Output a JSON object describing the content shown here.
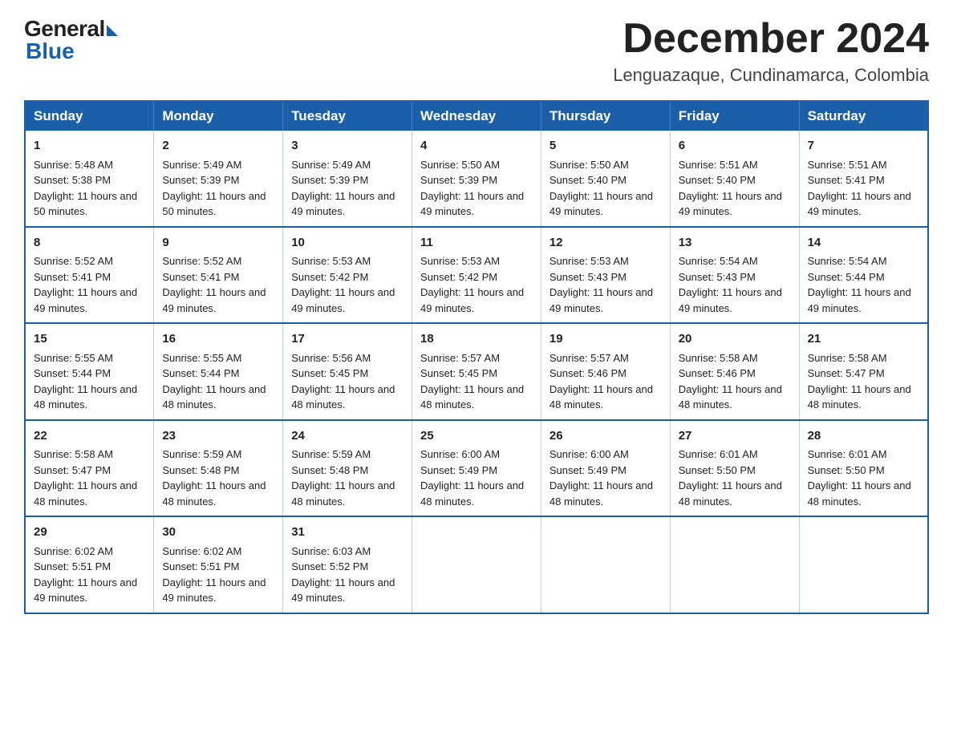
{
  "logo": {
    "general": "General",
    "blue": "Blue"
  },
  "header": {
    "title": "December 2024",
    "subtitle": "Lenguazaque, Cundinamarca, Colombia"
  },
  "weekdays": [
    "Sunday",
    "Monday",
    "Tuesday",
    "Wednesday",
    "Thursday",
    "Friday",
    "Saturday"
  ],
  "weeks": [
    [
      {
        "day": 1,
        "sunrise": "5:48 AM",
        "sunset": "5:38 PM",
        "daylight": "11 hours and 50 minutes."
      },
      {
        "day": 2,
        "sunrise": "5:49 AM",
        "sunset": "5:39 PM",
        "daylight": "11 hours and 50 minutes."
      },
      {
        "day": 3,
        "sunrise": "5:49 AM",
        "sunset": "5:39 PM",
        "daylight": "11 hours and 49 minutes."
      },
      {
        "day": 4,
        "sunrise": "5:50 AM",
        "sunset": "5:39 PM",
        "daylight": "11 hours and 49 minutes."
      },
      {
        "day": 5,
        "sunrise": "5:50 AM",
        "sunset": "5:40 PM",
        "daylight": "11 hours and 49 minutes."
      },
      {
        "day": 6,
        "sunrise": "5:51 AM",
        "sunset": "5:40 PM",
        "daylight": "11 hours and 49 minutes."
      },
      {
        "day": 7,
        "sunrise": "5:51 AM",
        "sunset": "5:41 PM",
        "daylight": "11 hours and 49 minutes."
      }
    ],
    [
      {
        "day": 8,
        "sunrise": "5:52 AM",
        "sunset": "5:41 PM",
        "daylight": "11 hours and 49 minutes."
      },
      {
        "day": 9,
        "sunrise": "5:52 AM",
        "sunset": "5:41 PM",
        "daylight": "11 hours and 49 minutes."
      },
      {
        "day": 10,
        "sunrise": "5:53 AM",
        "sunset": "5:42 PM",
        "daylight": "11 hours and 49 minutes."
      },
      {
        "day": 11,
        "sunrise": "5:53 AM",
        "sunset": "5:42 PM",
        "daylight": "11 hours and 49 minutes."
      },
      {
        "day": 12,
        "sunrise": "5:53 AM",
        "sunset": "5:43 PM",
        "daylight": "11 hours and 49 minutes."
      },
      {
        "day": 13,
        "sunrise": "5:54 AM",
        "sunset": "5:43 PM",
        "daylight": "11 hours and 49 minutes."
      },
      {
        "day": 14,
        "sunrise": "5:54 AM",
        "sunset": "5:44 PM",
        "daylight": "11 hours and 49 minutes."
      }
    ],
    [
      {
        "day": 15,
        "sunrise": "5:55 AM",
        "sunset": "5:44 PM",
        "daylight": "11 hours and 48 minutes."
      },
      {
        "day": 16,
        "sunrise": "5:55 AM",
        "sunset": "5:44 PM",
        "daylight": "11 hours and 48 minutes."
      },
      {
        "day": 17,
        "sunrise": "5:56 AM",
        "sunset": "5:45 PM",
        "daylight": "11 hours and 48 minutes."
      },
      {
        "day": 18,
        "sunrise": "5:57 AM",
        "sunset": "5:45 PM",
        "daylight": "11 hours and 48 minutes."
      },
      {
        "day": 19,
        "sunrise": "5:57 AM",
        "sunset": "5:46 PM",
        "daylight": "11 hours and 48 minutes."
      },
      {
        "day": 20,
        "sunrise": "5:58 AM",
        "sunset": "5:46 PM",
        "daylight": "11 hours and 48 minutes."
      },
      {
        "day": 21,
        "sunrise": "5:58 AM",
        "sunset": "5:47 PM",
        "daylight": "11 hours and 48 minutes."
      }
    ],
    [
      {
        "day": 22,
        "sunrise": "5:58 AM",
        "sunset": "5:47 PM",
        "daylight": "11 hours and 48 minutes."
      },
      {
        "day": 23,
        "sunrise": "5:59 AM",
        "sunset": "5:48 PM",
        "daylight": "11 hours and 48 minutes."
      },
      {
        "day": 24,
        "sunrise": "5:59 AM",
        "sunset": "5:48 PM",
        "daylight": "11 hours and 48 minutes."
      },
      {
        "day": 25,
        "sunrise": "6:00 AM",
        "sunset": "5:49 PM",
        "daylight": "11 hours and 48 minutes."
      },
      {
        "day": 26,
        "sunrise": "6:00 AM",
        "sunset": "5:49 PM",
        "daylight": "11 hours and 48 minutes."
      },
      {
        "day": 27,
        "sunrise": "6:01 AM",
        "sunset": "5:50 PM",
        "daylight": "11 hours and 48 minutes."
      },
      {
        "day": 28,
        "sunrise": "6:01 AM",
        "sunset": "5:50 PM",
        "daylight": "11 hours and 48 minutes."
      }
    ],
    [
      {
        "day": 29,
        "sunrise": "6:02 AM",
        "sunset": "5:51 PM",
        "daylight": "11 hours and 49 minutes."
      },
      {
        "day": 30,
        "sunrise": "6:02 AM",
        "sunset": "5:51 PM",
        "daylight": "11 hours and 49 minutes."
      },
      {
        "day": 31,
        "sunrise": "6:03 AM",
        "sunset": "5:52 PM",
        "daylight": "11 hours and 49 minutes."
      },
      null,
      null,
      null,
      null
    ]
  ]
}
